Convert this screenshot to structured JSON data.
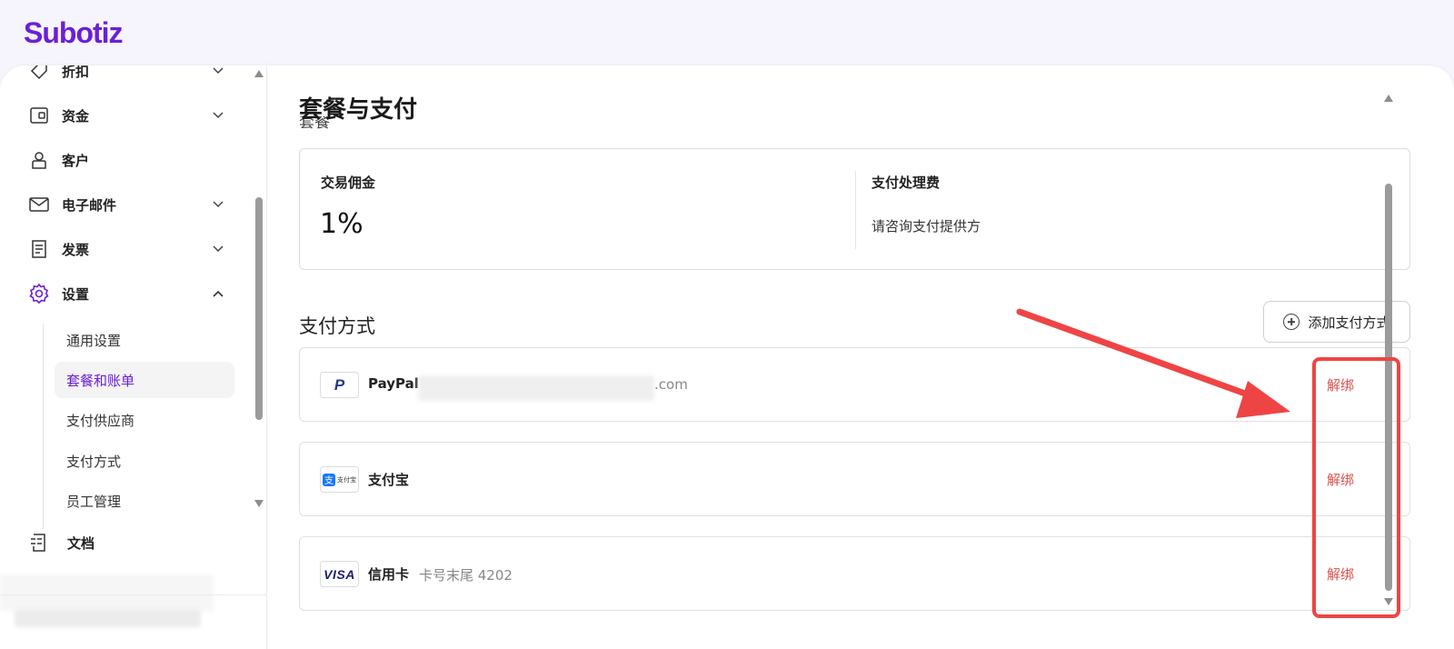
{
  "app": {
    "brand": "Subotiz",
    "brand_color": "#6b1fd6"
  },
  "sidebar": {
    "items": [
      {
        "label": "折扣",
        "icon": "tag-icon",
        "expandable": true,
        "expanded": false
      },
      {
        "label": "资金",
        "icon": "wallet-icon",
        "expandable": true,
        "expanded": false
      },
      {
        "label": "客户",
        "icon": "user-icon",
        "expandable": false
      },
      {
        "label": "电子邮件",
        "icon": "mail-icon",
        "expandable": true,
        "expanded": false
      },
      {
        "label": "发票",
        "icon": "invoice-icon",
        "expandable": true,
        "expanded": false
      },
      {
        "label": "设置",
        "icon": "gear-icon",
        "expandable": true,
        "expanded": true
      },
      {
        "label": "文档",
        "icon": "document-icon",
        "expandable": false
      }
    ],
    "settings_children": [
      {
        "label": "通用设置",
        "active": false
      },
      {
        "label": "套餐和账单",
        "active": true
      },
      {
        "label": "支付供应商",
        "active": false
      },
      {
        "label": "支付方式",
        "active": false
      },
      {
        "label": "员工管理",
        "active": false
      }
    ]
  },
  "main": {
    "title": "套餐与支付",
    "clipped_subtitle": "套餐",
    "plan": {
      "commission_label": "交易佣金",
      "commission_value": "1%",
      "processing_label": "支付处理费",
      "processing_value": "请咨询支付提供方"
    },
    "payment_methods": {
      "title": "支付方式",
      "add_label": "添加支付方式",
      "items": [
        {
          "logo": "paypal-logo",
          "name": "PayPal",
          "detail": ".com",
          "action": "解绑"
        },
        {
          "logo": "alipay-logo",
          "name": "支付宝",
          "detail": "",
          "action": "解绑"
        },
        {
          "logo": "visa-logo",
          "name": "信用卡",
          "detail": "卡号末尾 4202",
          "action": "解绑"
        }
      ]
    }
  },
  "logos": {
    "paypal": "P",
    "alipay_mark": "支",
    "alipay_text": "支付宝",
    "visa": "VISA"
  },
  "colors": {
    "unbind": "#d9534f",
    "annotation": "#ef4444",
    "active_text": "#6b1fd6"
  }
}
